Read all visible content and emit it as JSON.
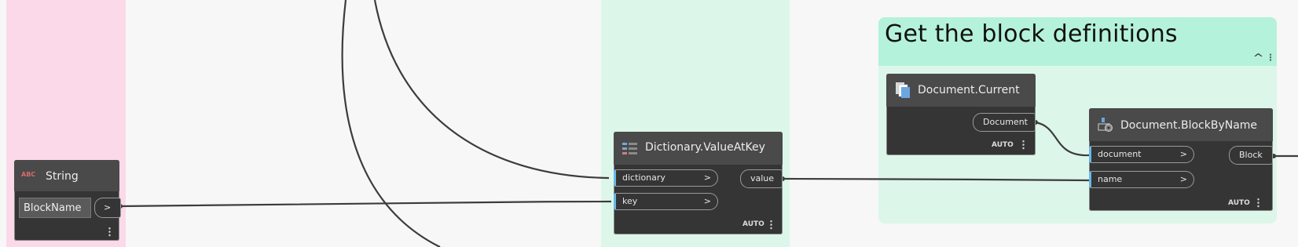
{
  "group": {
    "title": "Get the block definitions"
  },
  "nodes": {
    "string": {
      "title": "String",
      "value": "BlockName",
      "output_arrow": ">"
    },
    "value_at_key": {
      "title": "Dictionary.ValueAtKey",
      "inputs": [
        {
          "label": "dictionary",
          "arrow": ">"
        },
        {
          "label": "key",
          "arrow": ">"
        }
      ],
      "output": "value",
      "lacing": "AUTO"
    },
    "document_current": {
      "title": "Document.Current",
      "output": "Document",
      "lacing": "AUTO"
    },
    "block_by_name": {
      "title": "Document.BlockByName",
      "inputs": [
        {
          "label": "document",
          "arrow": ">"
        },
        {
          "label": "name",
          "arrow": ">"
        }
      ],
      "output": "Block",
      "lacing": "AUTO"
    }
  },
  "icons": {
    "string_icon": "abc-text-icon",
    "dictionary_icon": "dictionary-list-icon",
    "document_icon": "documents-icon",
    "block_icon": "block-gear-icon"
  }
}
